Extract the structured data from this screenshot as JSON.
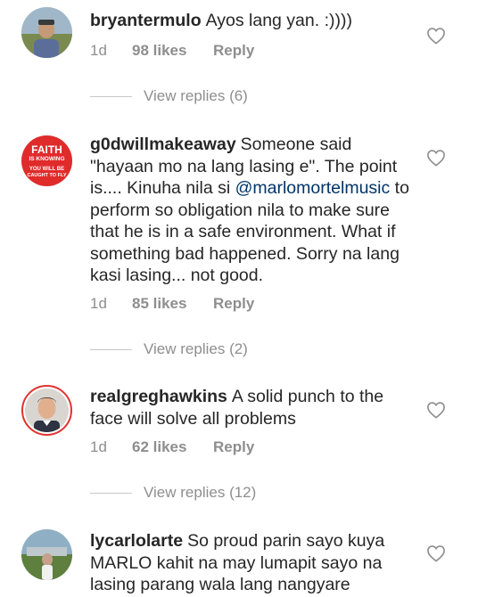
{
  "comments": [
    {
      "username": "bryantermulo",
      "text": "Ayos lang yan. :))))",
      "age": "1d",
      "likes": "98 likes",
      "reply": "Reply",
      "view_replies": "View replies (6)"
    },
    {
      "username": "g0dwillmakeaway",
      "text_before": "Someone said \"hayaan mo na lang lasing e\". The point is.... Kinuha nila si ",
      "mention": "@marlomortelmusic",
      "text_after": " to perform so obligation nila to make sure that he is in a safe environment. What if something  bad happened. Sorry na lang kasi lasing... not good.",
      "avatar_text": [
        "FAITH",
        "IS KNOWING",
        "YOU WILL BE",
        "CAUGHT TO FLY"
      ],
      "age": "1d",
      "likes": "85 likes",
      "reply": "Reply",
      "view_replies": "View replies (2)"
    },
    {
      "username": "realgreghawkins",
      "text": "A solid punch to the face will solve all problems",
      "age": "1d",
      "likes": "62 likes",
      "reply": "Reply",
      "view_replies": "View replies (12)"
    },
    {
      "username": "lycarlolarte",
      "text": "So proud parin sayo kuya MARLO kahit na may lumapit sayo na lasing parang wala lang nangyare"
    }
  ],
  "colors": {
    "text": "#262626",
    "secondary": "#8e8e8e",
    "mention": "#003569",
    "story_ring": "#e0342f"
  },
  "icons": {
    "like": "heart-outline-icon"
  }
}
